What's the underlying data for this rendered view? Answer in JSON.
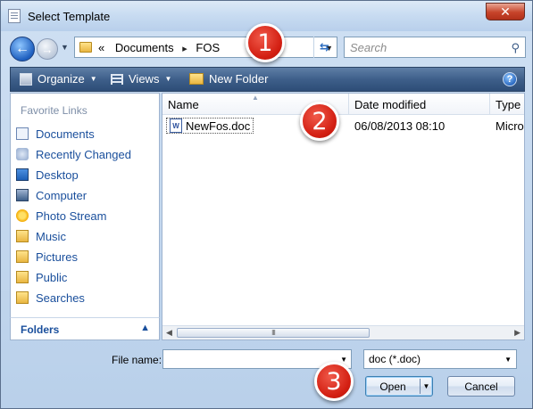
{
  "window": {
    "title": "Select Template",
    "close_label": "✕"
  },
  "address": {
    "crumb_prefix": "«",
    "crumbs": [
      "Documents",
      "FOS"
    ],
    "crumb_sep": "▸",
    "search_placeholder": "Search"
  },
  "toolbar": {
    "organize": "Organize",
    "views": "Views",
    "new_folder": "New Folder",
    "help": "?"
  },
  "nav": {
    "header": "Favorite Links",
    "items": [
      "Documents",
      "Recently Changed",
      "Desktop",
      "Computer",
      "Photo Stream",
      "Music",
      "Pictures",
      "Public",
      "Searches"
    ],
    "icons": [
      "document-icon",
      "recent-icon",
      "desktop-icon",
      "computer-icon",
      "photo-stream-icon",
      "folder-icon",
      "folder-icon",
      "folder-icon",
      "folder-icon"
    ],
    "folders_label": "Folders"
  },
  "filelist": {
    "columns": [
      "Name",
      "Date modified",
      "Type"
    ],
    "rows": [
      {
        "name": "NewFos.doc",
        "date": "06/08/2013 08:10",
        "type": "Microso"
      }
    ],
    "scroll_grip": "III"
  },
  "bottom": {
    "file_name_label": "File name:",
    "file_name_value": "",
    "file_type": "doc (*.doc)",
    "open": "Open",
    "cancel": "Cancel"
  },
  "callouts": [
    "1",
    "2",
    "3"
  ],
  "colors": {
    "callout": "#d31f12",
    "toolbar": "#3e5f8a",
    "link": "#1a4f9c"
  }
}
